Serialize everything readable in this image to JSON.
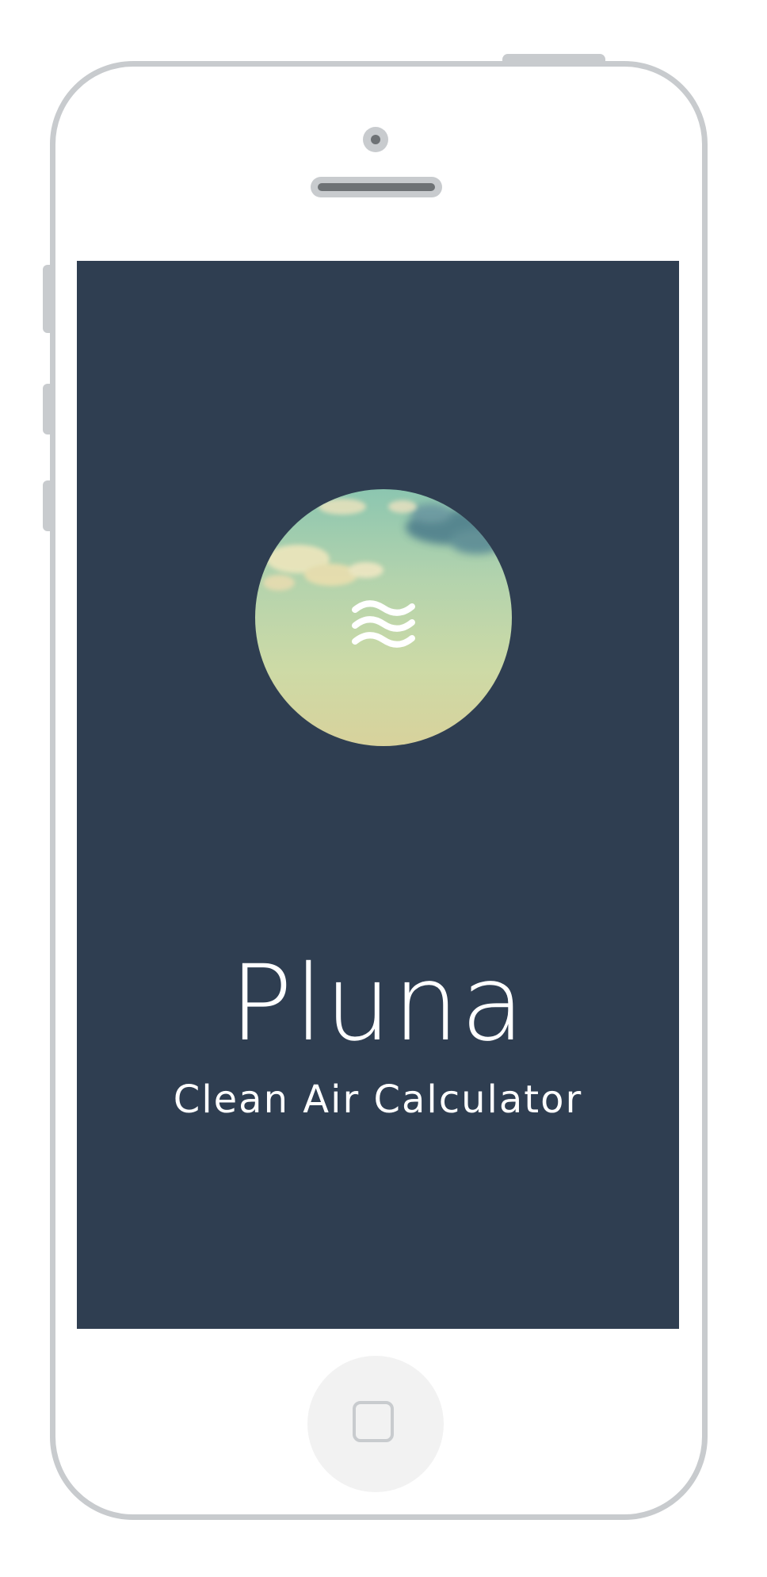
{
  "app": {
    "title": "Pluna",
    "subtitle": "Clean Air Calculator"
  },
  "icons": {
    "logo": "air-waves-icon",
    "home": "home-square-icon"
  },
  "colors": {
    "screen_background": "#2f3e51",
    "phone_frame": "#c8cbce",
    "text": "#ffffff"
  }
}
